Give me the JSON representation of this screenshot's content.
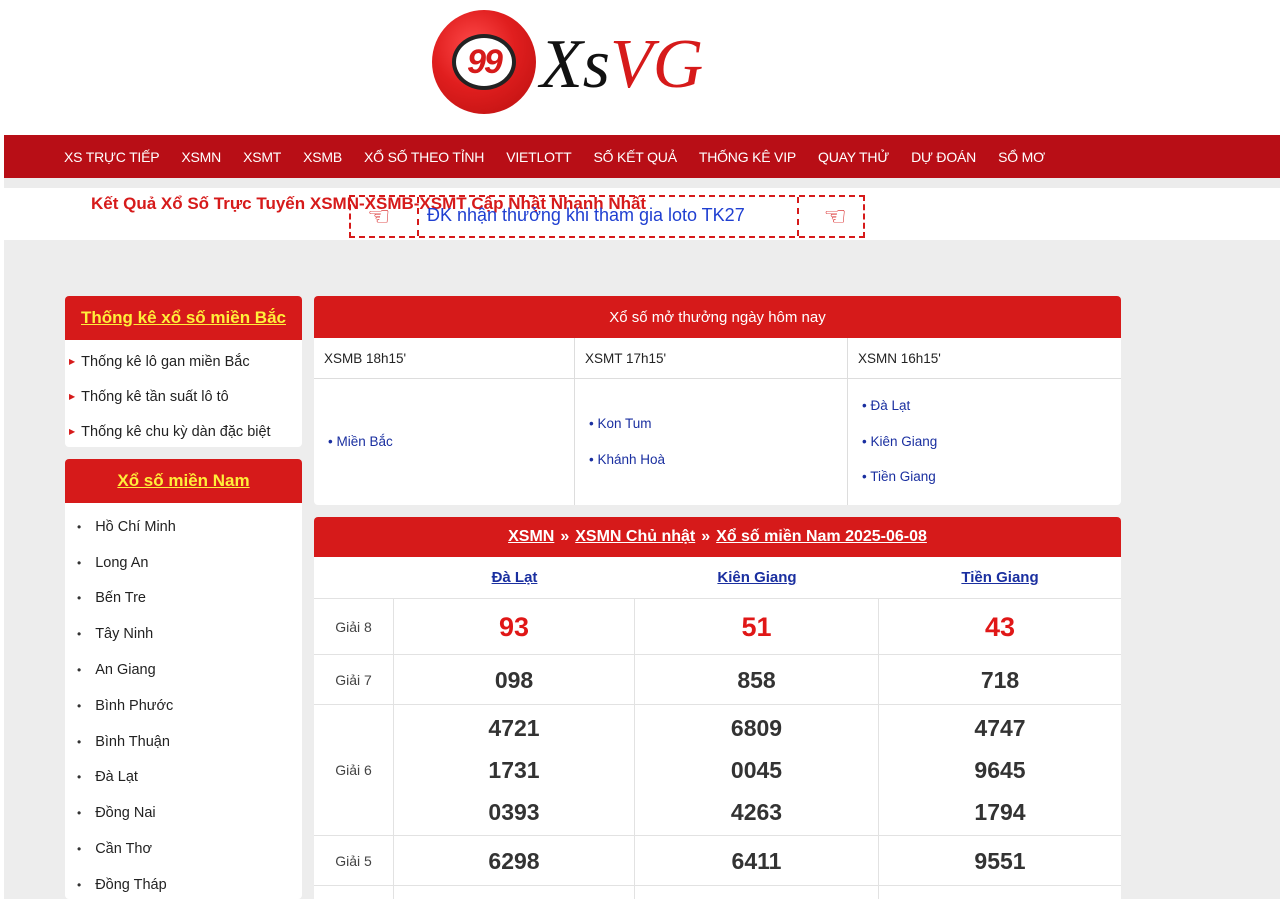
{
  "logo": {
    "ball_number": "99",
    "word_part1": "Xs",
    "word_part2": "VG"
  },
  "nav": {
    "items": [
      "XS TRỰC TIẾP",
      "XSMN",
      "XSMT",
      "XSMB",
      "XỔ SỐ THEO TỈNH",
      "VIETLOTT",
      "SỐ KẾT QUẢ",
      "THỐNG KÊ VIP",
      "QUAY THỬ",
      "DỰ ĐOÁN",
      "SỔ MƠ"
    ]
  },
  "marquee": {
    "title": "Kết Quả Xổ Số Trực Tuyến XSMN-XSMB-XSMT Cập Nhật Nhanh Nhất",
    "promo": "ĐK nhận thưởng khi tham gia loto TK27"
  },
  "sidebar": {
    "bac": {
      "title": "Thống kê xổ số miền Bắc",
      "items": [
        "Thống kê lô gan miền Bắc",
        "Thống kê tần suất lô tô",
        "Thống kê chu kỳ dàn đặc biệt"
      ]
    },
    "nam": {
      "title": "Xổ số miền Nam",
      "items": [
        "Hồ Chí Minh",
        "Long An",
        "Bến Tre",
        "Tây Ninh",
        "An Giang",
        "Bình Phước",
        "Bình Thuận",
        "Đà Lạt",
        "Đồng Nai",
        "Cần Thơ",
        "Đồng Tháp"
      ]
    }
  },
  "today": {
    "title": "Xổ số mở thưởng ngày hôm nay",
    "columns": [
      {
        "label": "XSMB 18h15'",
        "links": [
          "• Miền Bắc"
        ]
      },
      {
        "label": "XSMT 17h15'",
        "links": [
          "• Kon Tum",
          "• Khánh Hoà"
        ]
      },
      {
        "label": "XSMN 16h15'",
        "links": [
          "• Đà Lạt",
          "• Kiên Giang",
          "• Tiền Giang"
        ]
      }
    ]
  },
  "results": {
    "breadcrumb": [
      "XSMN",
      "XSMN Chủ nhật",
      "Xổ số miền Nam 2025-06-08"
    ],
    "separator": "»",
    "provinces": [
      "Đà Lạt",
      "Kiên Giang",
      "Tiền Giang"
    ],
    "prizes": [
      {
        "label": "Giải 8",
        "values": [
          [
            "93"
          ],
          [
            "51"
          ],
          [
            "43"
          ]
        ]
      },
      {
        "label": "Giải 7",
        "values": [
          [
            "098"
          ],
          [
            "858"
          ],
          [
            "718"
          ]
        ]
      },
      {
        "label": "Giải 6",
        "values": [
          [
            "4721",
            "1731",
            "0393"
          ],
          [
            "6809",
            "0045",
            "4263"
          ],
          [
            "4747",
            "9645",
            "1794"
          ]
        ]
      },
      {
        "label": "Giải 5",
        "values": [
          [
            "6298"
          ],
          [
            "6411"
          ],
          [
            "9551"
          ]
        ]
      }
    ]
  },
  "colors": {
    "brand_red": "#d61a1a",
    "nav_red": "#b80e16",
    "link_blue": "#1a2fa0",
    "sidebar_title_yellow": "#ffef3a"
  }
}
